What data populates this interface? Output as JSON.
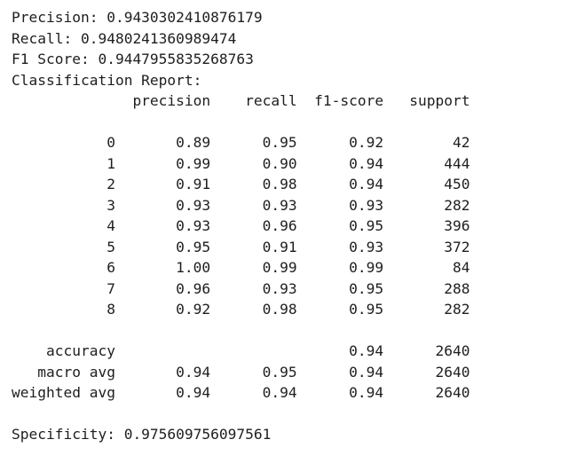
{
  "output": {
    "lines": [
      "Precision: 0.9430302410876179",
      "Recall: 0.9480241360989474",
      "F1 Score: 0.9447955835268763",
      "Classification Report:",
      "              precision    recall  f1-score   support",
      "",
      "           0       0.89      0.95      0.92        42",
      "           1       0.99      0.90      0.94       444",
      "           2       0.91      0.98      0.94       450",
      "           3       0.93      0.93      0.93       282",
      "           4       0.93      0.96      0.95       396",
      "           5       0.95      0.91      0.93       372",
      "           6       1.00      0.99      0.99        84",
      "           7       0.96      0.93      0.95       288",
      "           8       0.92      0.98      0.95       282",
      "",
      "    accuracy                           0.94      2640",
      "   macro avg       0.94      0.95      0.94      2640",
      "weighted avg       0.94      0.94      0.94      2640",
      "",
      "Specificity: 0.975609756097561"
    ]
  }
}
